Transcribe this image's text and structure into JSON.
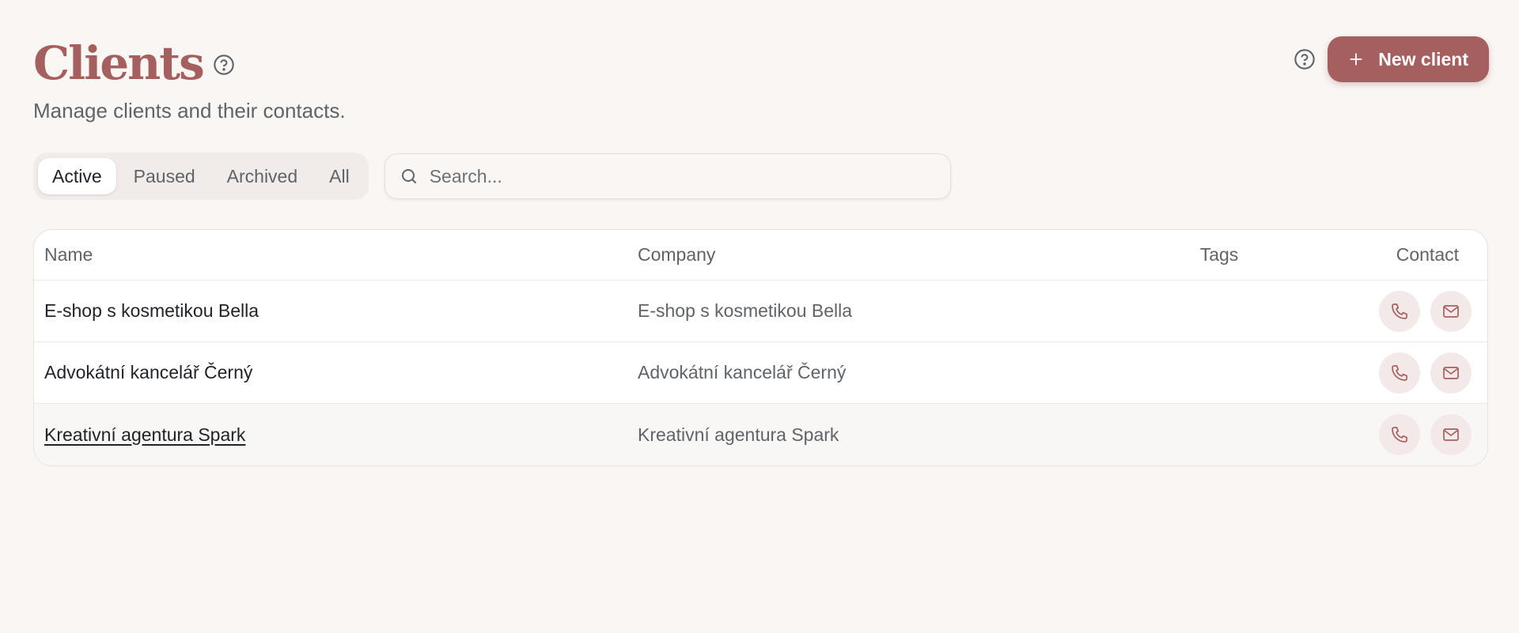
{
  "header": {
    "title": "Clients",
    "subtitle": "Manage clients and their contacts.",
    "help_icon": "question-circle-icon"
  },
  "actions": {
    "help_icon": "question-circle-icon",
    "new_client_label": "New client",
    "new_client_icon": "plus-icon"
  },
  "filters": {
    "tabs": [
      {
        "label": "Active",
        "active": true
      },
      {
        "label": "Paused",
        "active": false
      },
      {
        "label": "Archived",
        "active": false
      },
      {
        "label": "All",
        "active": false
      }
    ]
  },
  "search": {
    "placeholder": "Search...",
    "value": "",
    "icon": "search-icon"
  },
  "table": {
    "columns": {
      "name": "Name",
      "company": "Company",
      "tags": "Tags",
      "contact": "Contact"
    },
    "rows": [
      {
        "name": "E-shop s kosmetikou Bella",
        "company": "E-shop s kosmetikou Bella",
        "tags": ""
      },
      {
        "name": "Advokátní kancelář Černý",
        "company": "Advokátní kancelář Černý",
        "tags": ""
      },
      {
        "name": "Kreativní agentura Spark",
        "company": "Kreativní agentura Spark",
        "tags": ""
      }
    ]
  },
  "colors": {
    "accent": "#a55f5f",
    "background": "#faf6f4",
    "icon_bg": "#f3e9e8"
  }
}
